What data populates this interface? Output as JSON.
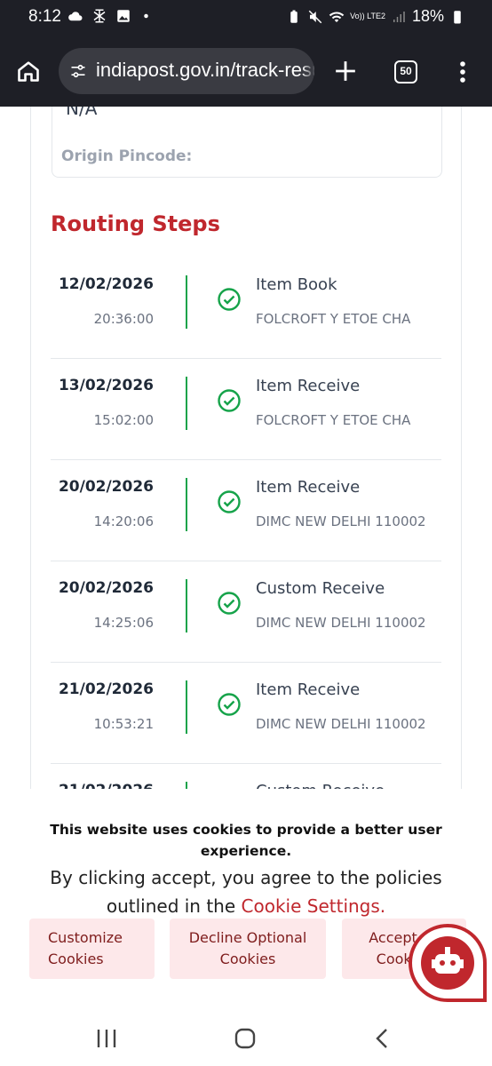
{
  "status_bar": {
    "time": "8:12",
    "battery": "18%",
    "network": "Vo)) LTE2"
  },
  "browser": {
    "url": "indiapost.gov.in/track-result",
    "tab_count": "50"
  },
  "page": {
    "previous_value": "N/A",
    "origin_pincode_label": "Origin Pincode:",
    "routing_title": "Routing Steps",
    "steps": [
      {
        "date": "12/02/2026",
        "time": "20:36:00",
        "status": "Item Book",
        "office": "FOLCROFT Y ETOE CHA"
      },
      {
        "date": "13/02/2026",
        "time": "15:02:00",
        "status": "Item Receive",
        "office": "FOLCROFT Y ETOE CHA"
      },
      {
        "date": "20/02/2026",
        "time": "14:20:06",
        "status": "Item Receive",
        "office": "DIMC NEW DELHI 110002"
      },
      {
        "date": "20/02/2026",
        "time": "14:25:06",
        "status": "Custom Receive",
        "office": "DIMC NEW DELHI 110002"
      },
      {
        "date": "21/02/2026",
        "time": "10:53:21",
        "status": "Item Receive",
        "office": "DIMC NEW DELHI 110002"
      },
      {
        "date": "21/02/2026",
        "time": "",
        "status": "Custom Receive",
        "office": ""
      }
    ]
  },
  "cookie_banner": {
    "title": "This website uses cookies to provide a better user experience.",
    "body": "By clicking accept, you agree to the policies outlined in the",
    "link": "Cookie Settings.",
    "customize_label": "Customize Cookies",
    "decline_label": "Decline Optional Cookies",
    "accept_label": "Accept All Cookies"
  },
  "colors": {
    "brand_red": "#c0272d",
    "success_green": "#16a34a",
    "button_bg": "#fde8ea"
  },
  "icons": [
    "home-icon",
    "tune-icon",
    "plus-icon",
    "tabs-icon",
    "more-vert-icon",
    "check-circle-icon",
    "chatbot-icon",
    "recents-icon",
    "nav-home-icon",
    "back-icon"
  ]
}
